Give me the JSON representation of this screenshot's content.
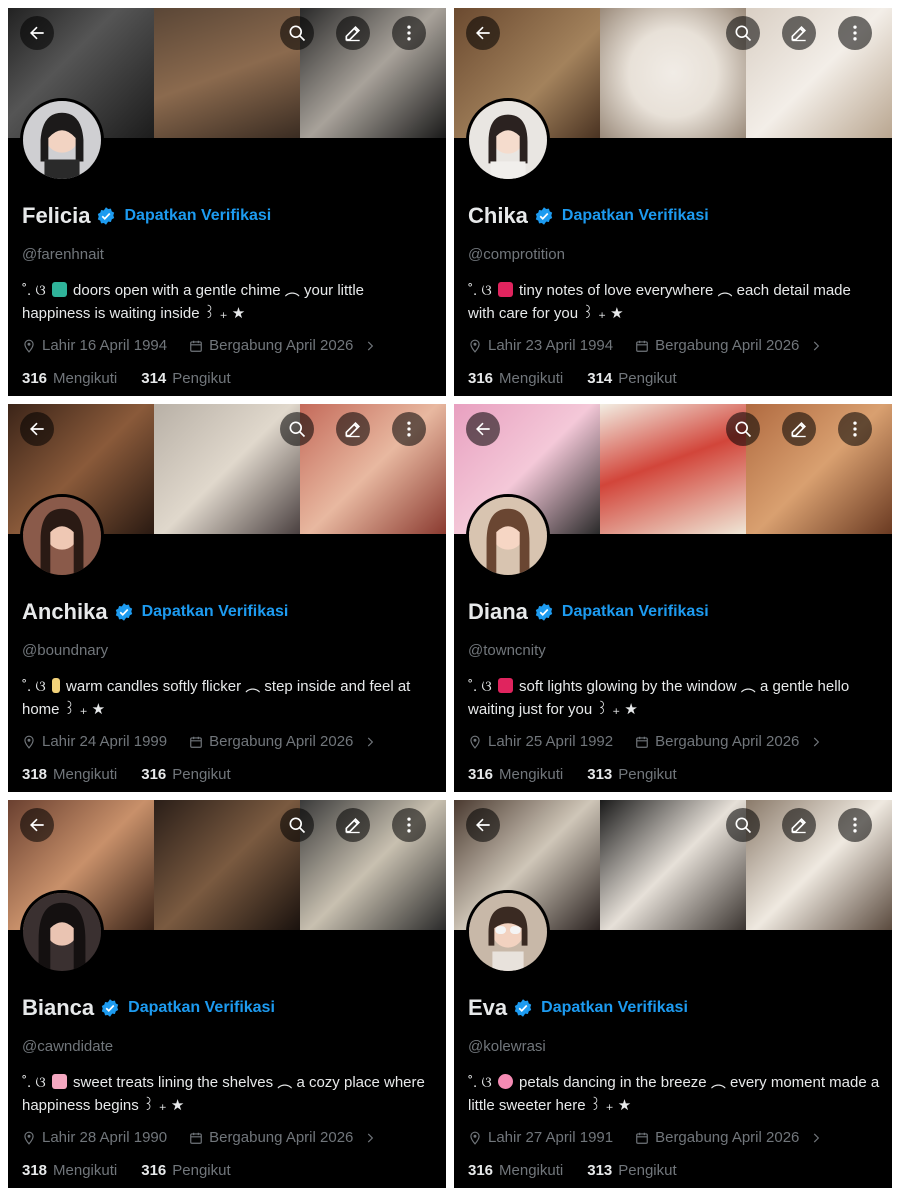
{
  "verify_label": "Dapatkan Verifikasi",
  "colors": {
    "accent": "#1d9bf0",
    "muted": "#71767b",
    "text": "#e7e9ea",
    "background": "#000000"
  },
  "icons": [
    "back-arrow-icon",
    "search-icon",
    "edit-icon",
    "more-icon",
    "verified-badge-icon",
    "location-icon",
    "calendar-icon",
    "chevron-right-icon"
  ],
  "profiles": [
    {
      "name": "Felicia",
      "handle": "@farenhnait",
      "bio_prefix": "˚. ଓ",
      "bio_text": "doors open with a gentle chime ︵ your little happiness is waiting inside ꒱ ₊ ★",
      "emoji_color": "#2fb39a",
      "birth": "Lahir 16 April 1994",
      "joined": "Bergabung April 2026",
      "following_count": "316",
      "following_label": "Mengikuti",
      "followers_count": "314",
      "followers_label": "Pengikut"
    },
    {
      "name": "Chika",
      "handle": "@comprotition",
      "bio_prefix": "˚. ଓ",
      "bio_text": "tiny notes of love everywhere ︵ each detail made with care for you ꒱ ₊ ★",
      "emoji_color": "#e0245e",
      "birth": "Lahir 23 April 1994",
      "joined": "Bergabung April 2026",
      "following_count": "316",
      "following_label": "Mengikuti",
      "followers_count": "314",
      "followers_label": "Pengikut"
    },
    {
      "name": "Anchika",
      "handle": "@boundnary",
      "bio_prefix": "˚. ଓ",
      "bio_text": "warm candles softly flicker ︵ step inside and feel at home ꒱ ₊ ★",
      "emoji_color": "#f2d27a",
      "birth": "Lahir 24 April 1999",
      "joined": "Bergabung April 2026",
      "following_count": "318",
      "following_label": "Mengikuti",
      "followers_count": "316",
      "followers_label": "Pengikut"
    },
    {
      "name": "Diana",
      "handle": "@towncnity",
      "bio_prefix": "˚. ଓ",
      "bio_text": "soft lights glowing by the window ︵ a gentle hello waiting just for you ꒱ ₊ ★",
      "emoji_color": "#e0245e",
      "birth": "Lahir 25 April 1992",
      "joined": "Bergabung April 2026",
      "following_count": "316",
      "following_label": "Mengikuti",
      "followers_count": "313",
      "followers_label": "Pengikut"
    },
    {
      "name": "Bianca",
      "handle": "@cawndidate",
      "bio_prefix": "˚. ଓ",
      "bio_text": "sweet treats lining the shelves ︵ a cozy place where happiness begins ꒱ ₊ ★",
      "emoji_color": "#f4a7c0",
      "birth": "Lahir 28 April 1990",
      "joined": "Bergabung April 2026",
      "following_count": "318",
      "following_label": "Mengikuti",
      "followers_count": "316",
      "followers_label": "Pengikut"
    },
    {
      "name": "Eva",
      "handle": "@kolewrasi",
      "bio_prefix": "˚. ଓ",
      "bio_text": "petals dancing in the breeze ︵ every moment made a little sweeter here ꒱ ₊ ★",
      "emoji_color": "#f58bb4",
      "birth": "Lahir 27 April 1991",
      "joined": "Bergabung April 2026",
      "following_count": "316",
      "following_label": "Mengikuti",
      "followers_count": "313",
      "followers_label": "Pengikut"
    }
  ]
}
